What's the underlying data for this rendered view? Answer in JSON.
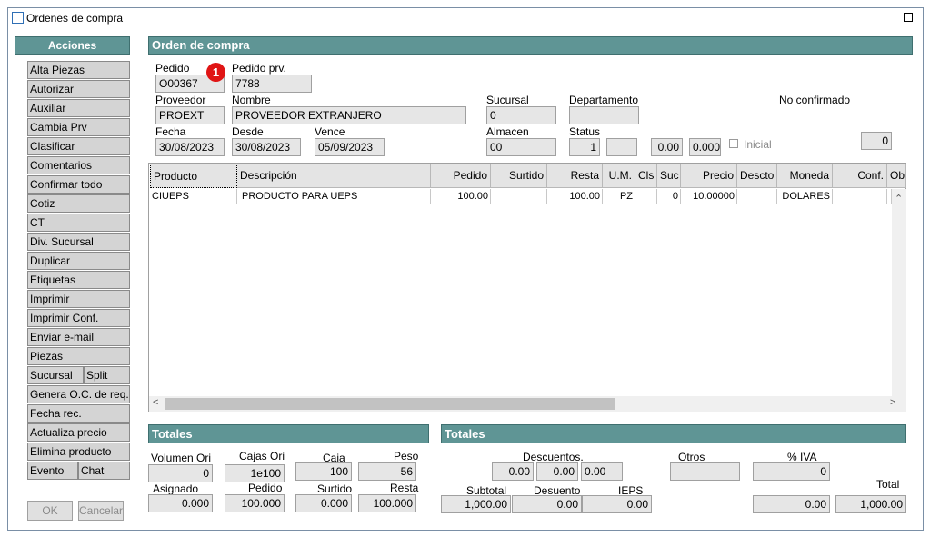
{
  "window": {
    "title": "Ordenes de compra"
  },
  "sidebar": {
    "header": "Acciones",
    "items": [
      "Alta Piezas",
      "Autorizar",
      "Auxiliar",
      "Cambia Prv",
      "Clasificar",
      "Comentarios",
      "Confirmar todo",
      "Cotiz",
      "CT",
      "Div. Sucursal",
      "Duplicar",
      "Etiquetas",
      "Imprimir",
      "Imprimir Conf.",
      "Enviar e-mail",
      "Piezas"
    ],
    "sucursal": "Sucursal",
    "split": "Split",
    "genera": "Genera O.C. de req.",
    "fecha_rec": "Fecha rec.",
    "actualiza": "Actualiza precio",
    "elimina": "Elimina producto",
    "evento": "Evento",
    "chat": "Chat",
    "ok": "OK",
    "cancelar": "Cancelar"
  },
  "order": {
    "header": "Orden de compra",
    "pedido_label": "Pedido",
    "pedido": "O00367",
    "badge": "1",
    "pedido_prv_label": "Pedido prv.",
    "pedido_prv": "7788",
    "proveedor_label": "Proveedor",
    "proveedor": "PROEXT",
    "nombre_label": "Nombre",
    "nombre": "PROVEEDOR EXTRANJERO",
    "sucursal_label": "Sucursal",
    "sucursal": "0",
    "departamento_label": "Departamento",
    "departamento": "",
    "status_text": "No confirmado",
    "fecha_label": "Fecha",
    "fecha": "30/08/2023",
    "desde_label": "Desde",
    "desde": "30/08/2023",
    "vence_label": "Vence",
    "vence": "05/09/2023",
    "almacen_label": "Almacen",
    "almacen": "00",
    "status_label": "Status",
    "status": "1",
    "status_extra": "",
    "val1": "0.00",
    "val2": "0.000",
    "inicial_label": "Inicial",
    "right_count": "0"
  },
  "grid": {
    "columns": [
      "Producto",
      "Descripción",
      "Pedido",
      "Surtido",
      "Resta",
      "U.M.",
      "Cls",
      "Suc",
      "Precio",
      "Descto",
      "Moneda",
      "Conf.",
      "Obs."
    ],
    "rows": [
      [
        "CIUEPS",
        "PRODUCTO PARA UEPS",
        "100.00",
        "",
        "100.00",
        "PZ",
        "",
        "0",
        "10.00000",
        "",
        "DOLARES",
        "",
        ""
      ]
    ]
  },
  "totales_left": {
    "header": "Totales",
    "volumen_label": "Volumen Ori",
    "volumen": "0",
    "cajas_label": "Cajas Ori",
    "cajas": "1e100",
    "caja_label": "Caja",
    "caja": "100",
    "peso_label": "Peso",
    "peso": "56",
    "asignado_label": "Asignado",
    "asignado": "0.000",
    "pedido_label": "Pedido",
    "pedido": "100.000",
    "surtido_label": "Surtido",
    "surtido": "0.000",
    "resta_label": "Resta",
    "resta": "100.000"
  },
  "totales_right": {
    "header": "Totales",
    "descuentos_label": "Descuentos.",
    "d1": "0.00",
    "d2": "0.00",
    "d3": "0.00",
    "otros_label": "Otros",
    "otros": "",
    "iva_label": "% IVA",
    "iva": "0",
    "subtotal_label": "Subtotal",
    "subtotal": "1,000.00",
    "desuento_label": "Desuento",
    "desuento": "0.00",
    "ieps_label": "IEPS",
    "ieps": "0.00",
    "iva_amount": "0.00",
    "total_label": "Total",
    "total": "1,000.00"
  }
}
